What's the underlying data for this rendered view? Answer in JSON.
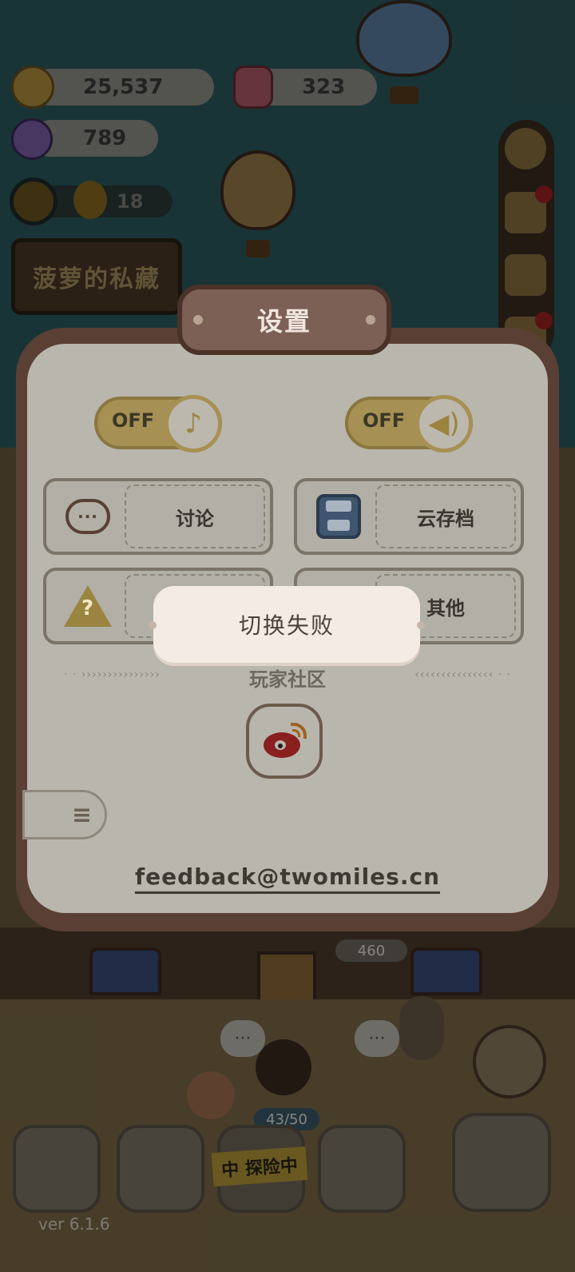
{
  "resources": {
    "coins": "25,537",
    "gems": "323",
    "candy": "789",
    "explorers": "18"
  },
  "sign": {
    "title": "菠萝的私藏"
  },
  "settings": {
    "title": "设置",
    "music_toggle": {
      "state": "OFF",
      "icon": "music-note-icon"
    },
    "sound_toggle": {
      "state": "OFF",
      "icon": "speaker-icon"
    },
    "buttons": [
      {
        "label": "讨论",
        "icon": "chat-bubble-icon"
      },
      {
        "label": "云存档",
        "icon": "floppy-disk-icon"
      },
      {
        "label": "",
        "icon": "question-warning-icon"
      },
      {
        "label": "其他",
        "icon": "info-icon"
      }
    ],
    "community_label": "玩家社区",
    "community_icon": "weibo-icon",
    "side_tab_icon": "notebook-icon",
    "feedback_email": "feedback@twomiles.cn"
  },
  "toast": {
    "message": "切换失败"
  },
  "hud": {
    "counter_price": "460",
    "capacity": "43/50",
    "explore_status": "中 探险中",
    "version": "ver 6.1.6",
    "chat_dots": "···"
  },
  "colors": {
    "overlay": "#000000",
    "panel_border": "#5a3f34",
    "panel_body": "#b9b6ad",
    "toggle_gold": "#a69053",
    "toast_bg": "#f3ebe4"
  }
}
